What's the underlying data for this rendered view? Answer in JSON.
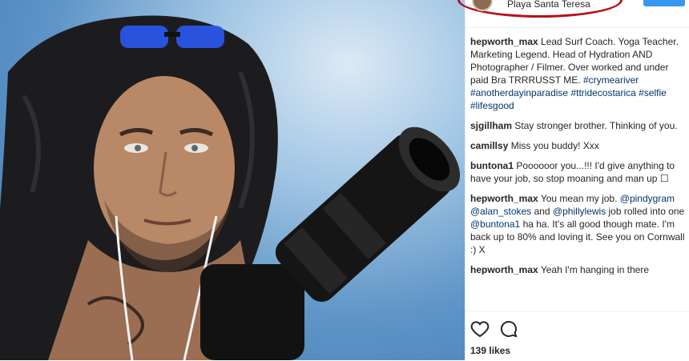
{
  "post": {
    "location": "Playa Santa Teresa",
    "likes": "139 likes"
  },
  "comments": [
    {
      "user": "hepworth_max",
      "text_plain": "Lead Surf Coach. Yoga Teacher. Marketing Legend. Head of Hydration AND Photographer / Filmer. Over worked and under paid Bra TRRRUSST ME.",
      "tags": [
        "#crymeariver",
        "#anotherdayinparadise",
        "#ttridecostarica",
        "#selfie",
        "#lifesgood"
      ]
    },
    {
      "user": "sjgillham",
      "text": "Stay stronger brother. Thinking of you."
    },
    {
      "user": "camillsy",
      "text": "Miss you buddy! Xxx"
    },
    {
      "user": "buntona1",
      "text": "Poooooor you...!!! I'd give anything to have your job, so stop moaning and man up ☐"
    },
    {
      "user": "hepworth_max",
      "text_a": "You mean my job.",
      "mention1": "@pindygram",
      "mention2": "@alan_stokes",
      "and1": "and",
      "mention3": "@phillylewis",
      "text_b": "job rolled into one",
      "mention4": "@buntona1",
      "text_c": "ha ha. It's all good though mate. I'm back up to 80% and loving it. See you on Cornwall :) X"
    },
    {
      "user": "hepworth_max",
      "text": "Yeah I'm hanging in there"
    }
  ],
  "icons": {
    "like": "heart-outline-icon",
    "comment": "speech-bubble-icon"
  }
}
